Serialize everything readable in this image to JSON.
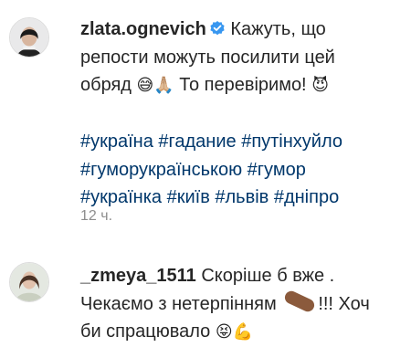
{
  "comments": [
    {
      "username": "zlata.ognevich",
      "verified": true,
      "text_line1": "Кажуть, що",
      "text_line2": "репости можуть посилити цей",
      "text_line3a": "обряд ",
      "emoji1": "😅🙏🏼",
      "text_line3b": " То перевіримо! ",
      "emoji2": "😈",
      "hashtags_line1": "#україна #гадание #путінхуйло",
      "hashtags_line2": "#гуморукраїнською #гумор",
      "hashtags_line3": "#українка #київ #львів #дніпро",
      "timestamp": "12 ч."
    },
    {
      "username": "_zmeya_1511",
      "text_line1": "Скоріше б вже .",
      "text_line2a": "Чекаємо з нетерпінням ",
      "text_line2b": "!!! Хоч",
      "text_line3": "би спрацювало ",
      "emoji_end": "😝💪"
    }
  ],
  "colors": {
    "hashtag": "#00376b",
    "verified_badge": "#3897f0",
    "timestamp": "#8e8e8e"
  }
}
